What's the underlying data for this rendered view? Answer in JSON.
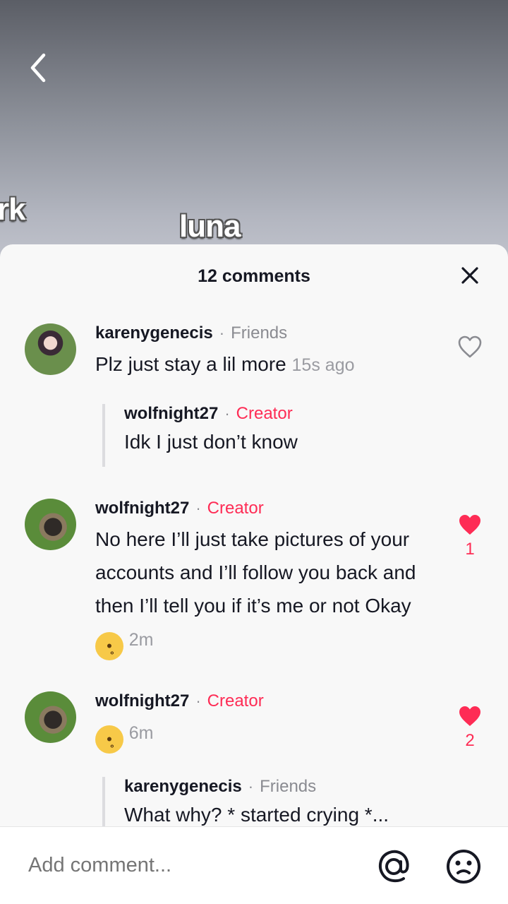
{
  "video": {
    "overlay_left": "rk",
    "overlay_center": "luna"
  },
  "sheet": {
    "title": "12 comments"
  },
  "comments": [
    {
      "username": "karenygenecis",
      "tag": "Friends",
      "text": "Plz just stay a lil more",
      "time": "15s ago",
      "liked": false,
      "reply": {
        "username": "wolfnight27",
        "tag": "Creator",
        "text": "Idk I just don’t know"
      }
    },
    {
      "username": "wolfnight27",
      "tag": "Creator",
      "text": "No here I’ll just take pictures of your accounts and I’ll follow you back and then I’ll tell you if it’s me or not Okay",
      "emoji": "pleading-face",
      "time": "2m",
      "liked": true,
      "likes": "1"
    },
    {
      "username": "wolfnight27",
      "tag": "Creator",
      "emoji": "pleading-face",
      "time": "6m",
      "liked": true,
      "likes": "2",
      "reply": {
        "username": "karenygenecis",
        "tag": "Friends",
        "text": "What why? * started crying *..."
      }
    }
  ],
  "input": {
    "placeholder": "Add comment..."
  },
  "colors": {
    "accent": "#fe2c55",
    "muted": "#8a8b91",
    "text": "#161823",
    "sheet_bg": "#f8f8f8"
  },
  "icons": [
    "back-arrow-icon",
    "close-icon",
    "heart-outline-icon",
    "heart-filled-icon",
    "at-mention-icon",
    "emoji-icon"
  ]
}
